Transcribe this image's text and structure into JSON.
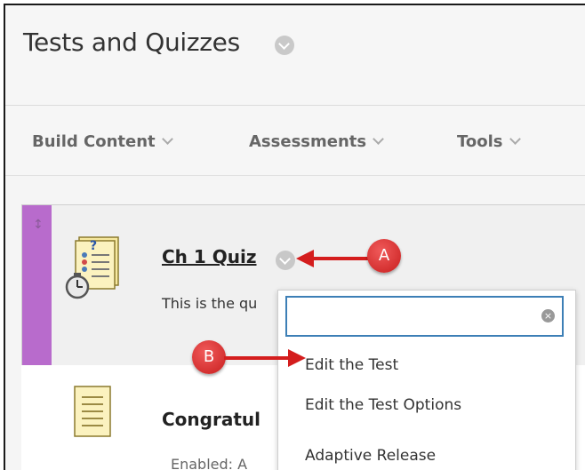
{
  "page": {
    "title": "Tests and Quizzes"
  },
  "menubar": {
    "items": [
      {
        "label": "Build Content"
      },
      {
        "label": "Assessments"
      },
      {
        "label": "Tools"
      }
    ]
  },
  "content": {
    "items": [
      {
        "title": "Ch 1 Quiz",
        "description": "This is the qu",
        "type": "test"
      },
      {
        "title": "Congratul",
        "description": "Enabled:  A",
        "type": "document"
      }
    ]
  },
  "dropdown": {
    "search_value": "",
    "options": [
      {
        "label": "Edit the Test"
      },
      {
        "label": "Edit the Test Options"
      },
      {
        "label": "Adaptive Release"
      }
    ]
  },
  "callouts": {
    "a": "A",
    "b": "B"
  },
  "colors": {
    "accent": "#b86bcc",
    "callout": "#d41d1d",
    "search_border": "#3d7fb6"
  }
}
